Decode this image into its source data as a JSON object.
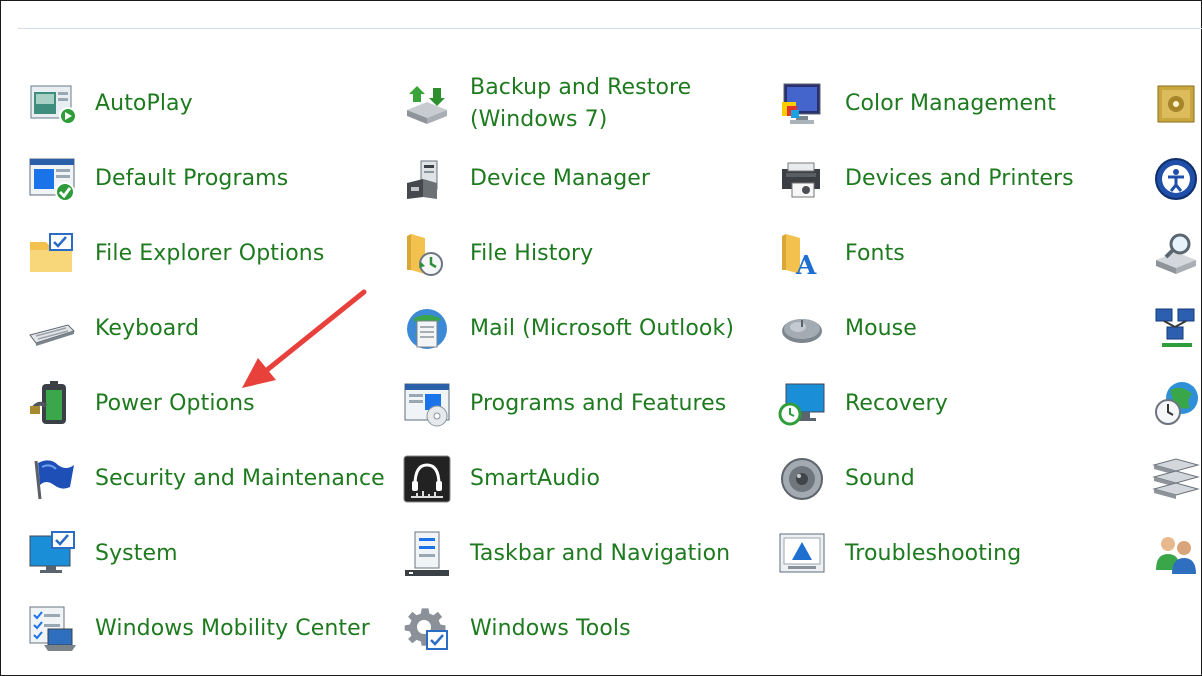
{
  "items": [
    {
      "label": "AutoPlay",
      "icon": "autoplay-icon"
    },
    {
      "label": "Backup and Restore",
      "label2": "(Windows 7)",
      "icon": "backup-restore-icon"
    },
    {
      "label": "Color Management",
      "icon": "color-management-icon"
    },
    {
      "label": "Default Programs",
      "icon": "default-programs-icon"
    },
    {
      "label": "Device Manager",
      "icon": "device-manager-icon"
    },
    {
      "label": "Devices and Printers",
      "icon": "devices-printers-icon"
    },
    {
      "label": "File Explorer Options",
      "icon": "folder-options-icon"
    },
    {
      "label": "File History",
      "icon": "file-history-icon"
    },
    {
      "label": "Fonts",
      "icon": "fonts-icon"
    },
    {
      "label": "Keyboard",
      "icon": "keyboard-icon"
    },
    {
      "label": "Mail (Microsoft Outlook)",
      "icon": "mail-icon"
    },
    {
      "label": "Mouse",
      "icon": "mouse-icon"
    },
    {
      "label": "Power Options",
      "icon": "power-options-icon"
    },
    {
      "label": "Programs and Features",
      "icon": "programs-features-icon"
    },
    {
      "label": "Recovery",
      "icon": "recovery-icon"
    },
    {
      "label": "Security and Maintenance",
      "icon": "security-flag-icon"
    },
    {
      "label": "SmartAudio",
      "icon": "headphones-icon"
    },
    {
      "label": "Sound",
      "icon": "speaker-icon"
    },
    {
      "label": "System",
      "icon": "system-icon"
    },
    {
      "label": "Taskbar and Navigation",
      "icon": "taskbar-icon"
    },
    {
      "label": "Troubleshooting",
      "icon": "troubleshooting-icon"
    },
    {
      "label": "Windows Mobility Center",
      "icon": "mobility-center-icon"
    },
    {
      "label": "Windows Tools",
      "icon": "windows-tools-icon"
    }
  ],
  "clipped_column_icons": [
    "safe-icon",
    "ease-of-access-icon",
    "indexing-icon",
    "network-icon",
    "date-time-icon",
    "storage-spaces-icon",
    "user-accounts-icon"
  ],
  "annotation": {
    "type": "red-arrow",
    "color": "#e8413b",
    "points_to": "Power Options"
  },
  "colors": {
    "link": "#1e7a1e",
    "rule": "#d6dde3"
  }
}
